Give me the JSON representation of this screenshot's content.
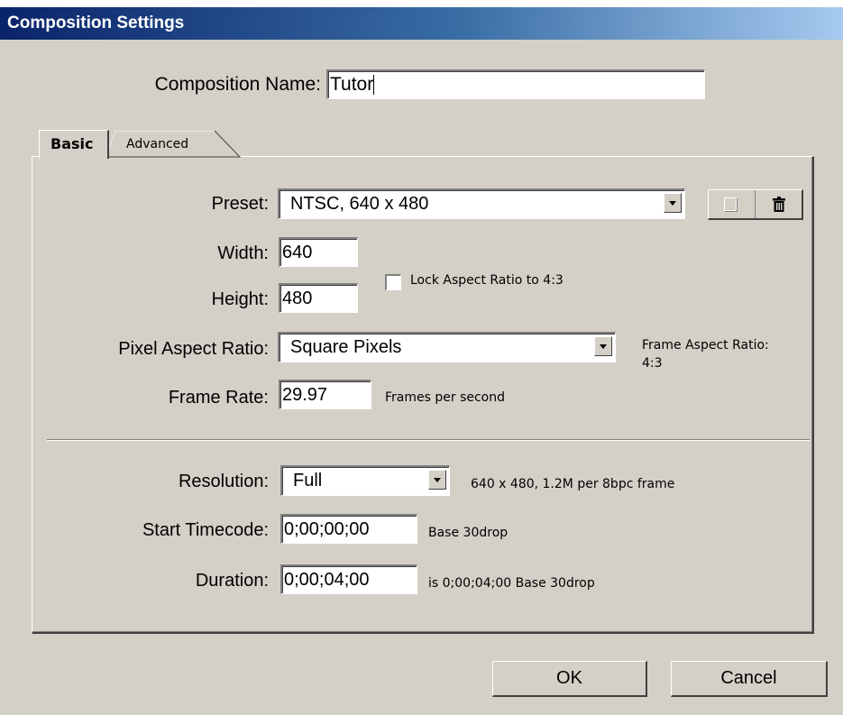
{
  "dialog": {
    "title": "Composition Settings",
    "name_label": "Composition Name:",
    "name_value": "Tutor"
  },
  "tabs": [
    {
      "label": "Basic",
      "active": true
    },
    {
      "label": "Advanced",
      "active": false
    }
  ],
  "basic": {
    "preset_label": "Preset:",
    "preset_value": "NTSC, 640 x 480",
    "width_label": "Width:",
    "width_value": "640",
    "height_label": "Height:",
    "height_value": "480",
    "lock_aspect_label": "Lock Aspect Ratio to 4:3",
    "lock_aspect_checked": false,
    "par_label": "Pixel Aspect Ratio:",
    "par_value": "Square Pixels",
    "frame_aspect_label": "Frame Aspect Ratio:",
    "frame_aspect_value": "4:3",
    "frame_rate_label": "Frame Rate:",
    "frame_rate_value": "29.97",
    "frame_rate_unit": "Frames per second",
    "resolution_label": "Resolution:",
    "resolution_value": "Full",
    "resolution_info": "640 x 480, 1.2M per 8bpc frame",
    "start_tc_label": "Start Timecode:",
    "start_tc_value": "0;00;00;00",
    "start_tc_base": "Base 30drop",
    "duration_label": "Duration:",
    "duration_value": "0;00;04;00",
    "duration_info": "is 0;00;04;00  Base 30drop"
  },
  "buttons": {
    "ok": "OK",
    "cancel": "Cancel"
  },
  "icons": {
    "preset_new": "new-preset-icon",
    "preset_delete": "trash-icon"
  }
}
